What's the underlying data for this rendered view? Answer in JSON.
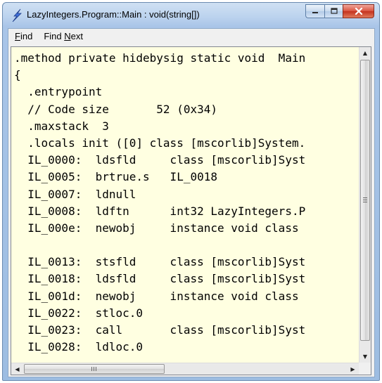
{
  "window": {
    "title": "LazyIntegers.Program::Main : void(string[])",
    "icon": "ildasm-lightning-icon"
  },
  "menu": [
    {
      "label": "Find",
      "accel_index": 0
    },
    {
      "label": "Find Next",
      "accel_index": 5
    }
  ],
  "code_lines": [
    ".method private hidebysig static void  Main",
    "{",
    "  .entrypoint",
    "  // Code size       52 (0x34)",
    "  .maxstack  3",
    "  .locals init ([0] class [mscorlib]System.",
    "  IL_0000:  ldsfld     class [mscorlib]Syst",
    "  IL_0005:  brtrue.s   IL_0018",
    "  IL_0007:  ldnull",
    "  IL_0008:  ldftn      int32 LazyIntegers.P",
    "  IL_000e:  newobj     instance void class",
    "",
    "  IL_0013:  stsfld     class [mscorlib]Syst",
    "  IL_0018:  ldsfld     class [mscorlib]Syst",
    "  IL_001d:  newobj     instance void class",
    "  IL_0022:  stloc.0",
    "  IL_0023:  call       class [mscorlib]Syst",
    "  IL_0028:  ldloc.0"
  ],
  "colors": {
    "text_background": "#ffffe1",
    "close_button": "#c4321e",
    "title_bar": "#bcd3ee"
  }
}
